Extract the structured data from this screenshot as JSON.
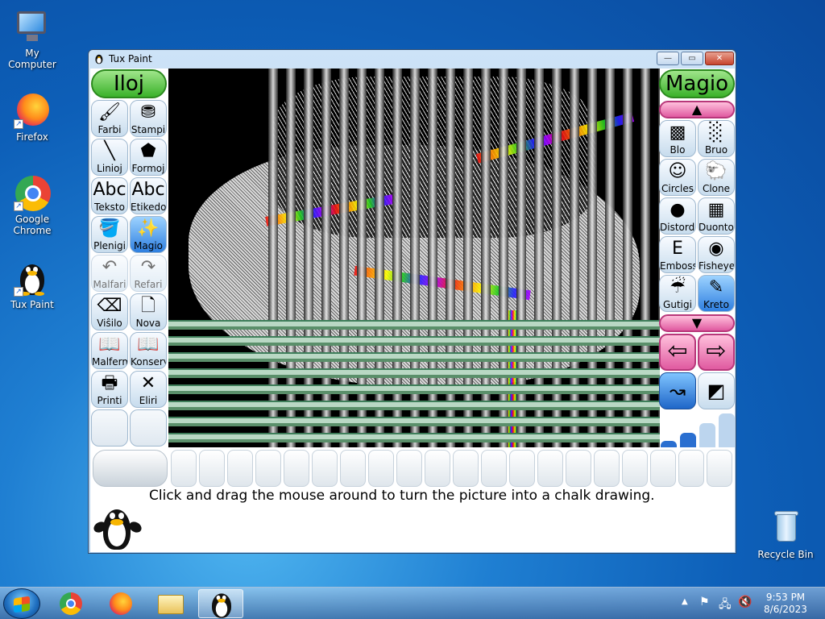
{
  "desktop": {
    "icons": [
      {
        "label": "My Computer"
      },
      {
        "label": "Firefox"
      },
      {
        "label": "Google Chrome"
      },
      {
        "label": "Tux Paint"
      },
      {
        "label": "Recycle Bin"
      }
    ]
  },
  "window": {
    "title": "Tux Paint",
    "controls": {
      "minimize": "—",
      "maximize": "▭",
      "close": "✕"
    }
  },
  "tuxpaint": {
    "tools_title": "Iloj",
    "magic_title": "Magio",
    "tools": [
      {
        "label": "Farbi",
        "glyph": "🖌"
      },
      {
        "label": "Stampi",
        "glyph": "⛃"
      },
      {
        "label": "Linioj",
        "glyph": "╲"
      },
      {
        "label": "Formoj",
        "glyph": "⬟"
      },
      {
        "label": "Teksto",
        "glyph": "Abc"
      },
      {
        "label": "Etikedo",
        "glyph": "Abc"
      },
      {
        "label": "Plenigi",
        "glyph": "🪣"
      },
      {
        "label": "Magio",
        "glyph": "✨"
      },
      {
        "label": "Malfari",
        "glyph": "↶"
      },
      {
        "label": "Refari",
        "glyph": "↷"
      },
      {
        "label": "Viŝilo",
        "glyph": "⌫"
      },
      {
        "label": "Nova",
        "glyph": "🗋"
      },
      {
        "label": "Malfermi",
        "glyph": "📖"
      },
      {
        "label": "Konservi",
        "glyph": "📖"
      },
      {
        "label": "Printi",
        "glyph": "🖶"
      },
      {
        "label": "Eliri",
        "glyph": "✕"
      }
    ],
    "magic_tools": [
      {
        "label": "Blo",
        "glyph": "▩"
      },
      {
        "label": "Bruo",
        "glyph": "░"
      },
      {
        "label": "Circles",
        "glyph": "☺"
      },
      {
        "label": "Clone",
        "glyph": "🐑"
      },
      {
        "label": "Distordo",
        "glyph": "●"
      },
      {
        "label": "Duontona",
        "glyph": "▦"
      },
      {
        "label": "Emboss",
        "glyph": "E"
      },
      {
        "label": "Fisheye",
        "glyph": "◉"
      },
      {
        "label": "Gutigi",
        "glyph": "☔"
      },
      {
        "label": "Kreto",
        "glyph": "✎"
      }
    ],
    "help_text": "Click and drag the mouse around to turn the picture into a chalk drawing."
  },
  "taskbar": {
    "time": "9:53 PM",
    "date": "8/6/2023"
  },
  "colors": {
    "accent_green": "#3bb22a",
    "accent_pink": "#e05aa0",
    "selected_blue": "#2e7fe0"
  }
}
